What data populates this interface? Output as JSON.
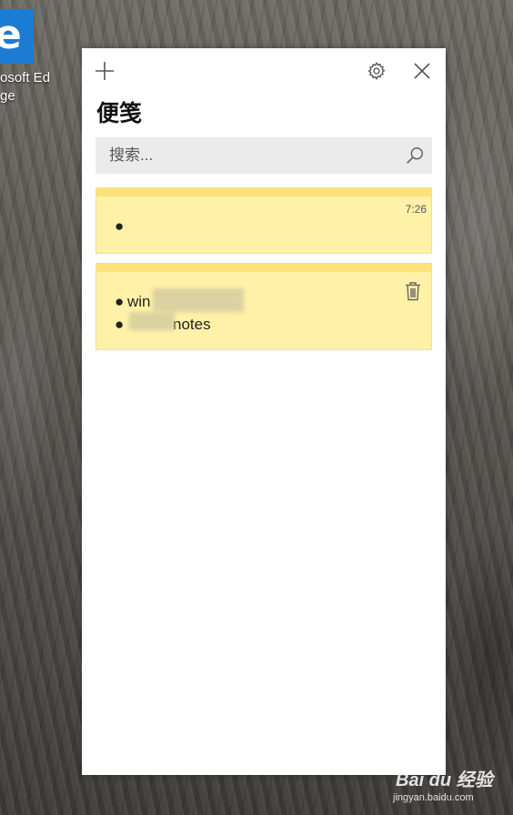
{
  "desktop": {
    "edge_icon": {
      "glyph": "e",
      "label_line1": "osoft Ed",
      "label_line2": "ge",
      "color": "#1c7bd3"
    },
    "watermark": {
      "main": "Bai du 经验",
      "sub": "jingyan.baidu.com"
    }
  },
  "window": {
    "title": "便笺",
    "toolbar": {
      "add_icon": "plus-icon",
      "settings_icon": "gear-icon",
      "close_icon": "close-icon"
    },
    "search": {
      "placeholder": "搜索...",
      "value": "",
      "icon": "search-icon"
    },
    "notes": [
      {
        "time": "7:26",
        "items": [
          ""
        ],
        "color": "#fff1a7"
      },
      {
        "items": [
          "win",
          "notes"
        ],
        "delete_icon": "trash-icon",
        "color": "#fff1a7"
      }
    ]
  }
}
